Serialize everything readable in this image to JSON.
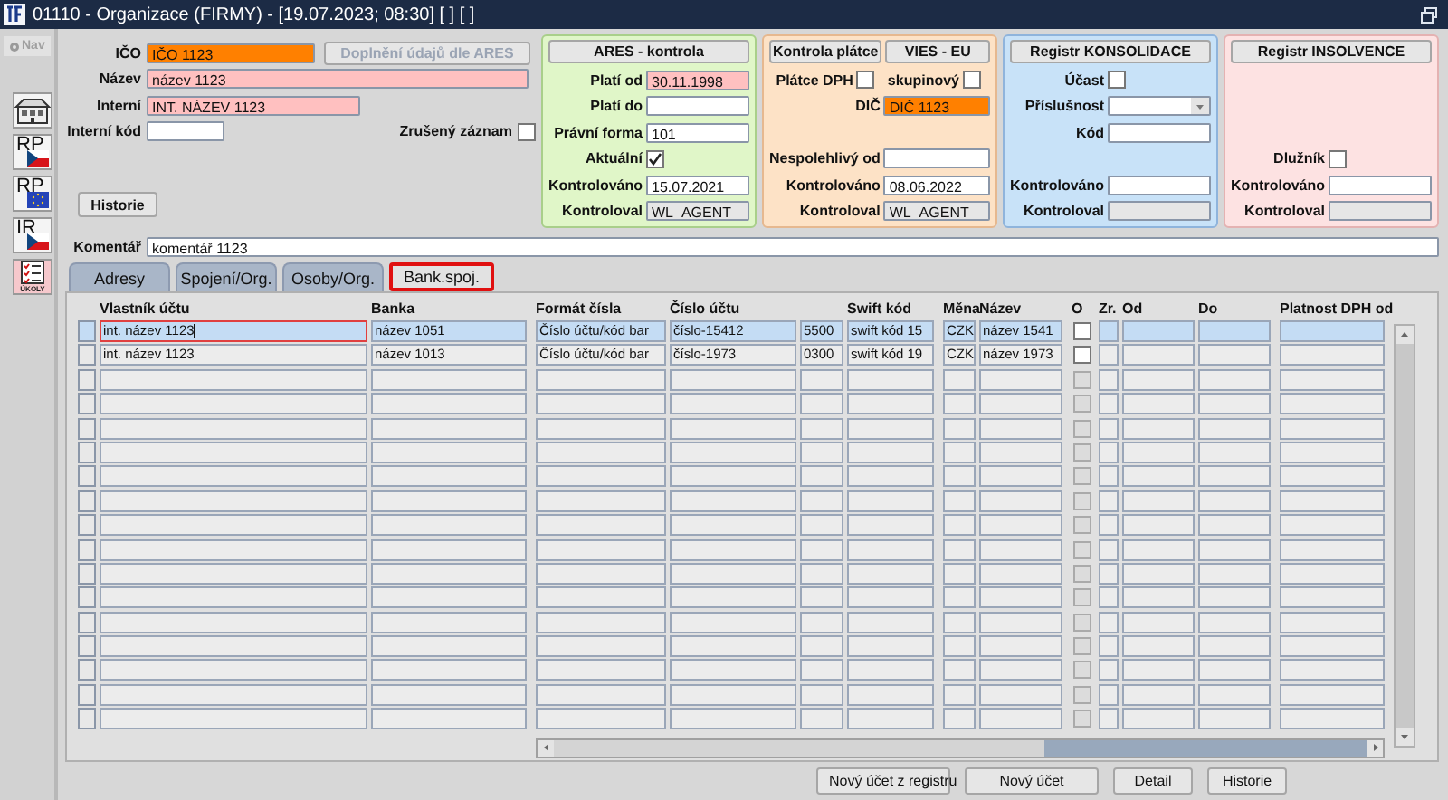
{
  "window": {
    "title": "01110 - Organizace (FIRMY) - [19.07.2023; 08:30] [ ] [ ]"
  },
  "toolbar": {
    "nav": {
      "label": "Nav",
      "disabled": true
    },
    "items": [
      {
        "kind": "building"
      },
      {
        "kind": "flag-cz",
        "label": "RP"
      },
      {
        "kind": "flag-eu",
        "label": "RP"
      },
      {
        "kind": "flag-cz",
        "label": "IR"
      },
      {
        "kind": "tasks",
        "label": "ÚKOLY"
      }
    ]
  },
  "form": {
    "ico": {
      "label": "IČO",
      "value": "IČO 1123",
      "color": "#ff8000"
    },
    "ares_button": {
      "label": "Doplnění údajů dle ARES",
      "disabled": true
    },
    "nazev": {
      "label": "Název",
      "value": "název 1123",
      "color": "#ffc0c0"
    },
    "interni": {
      "label": "Interní",
      "value": "INT. NÁZEV 1123",
      "color": "#ffc0c0"
    },
    "interni_kod": {
      "label": "Interní kód",
      "color": "#ffffff"
    },
    "zruseny": {
      "label": "Zrušený záznam",
      "checked": false
    },
    "historie_button": "Historie"
  },
  "panels": [
    {
      "titles": [
        "ARES - kontrola"
      ],
      "color": "#e0f6c8",
      "top": [
        {
          "kind": "field",
          "label": "Platí od",
          "value": "30.11.1998",
          "color": "#ffc0c0"
        },
        {
          "kind": "field",
          "label": "Platí do",
          "color": "#ffffff"
        },
        {
          "kind": "field",
          "label": "Právní forma",
          "value": "101",
          "color": "#ffffff"
        },
        {
          "kind": "checkbox",
          "label": "Aktuální",
          "checked": true
        }
      ],
      "bottom": [
        {
          "kind": "field",
          "label": "Kontrolováno",
          "value": "15.07.2021",
          "color": "#ffffff"
        },
        {
          "kind": "field",
          "label": "Kontroloval",
          "value": "WL_AGENT",
          "color": "#e6e6e6"
        }
      ]
    },
    {
      "titles": [
        "Kontrola plátce",
        "VIES - EU"
      ],
      "color": "#fde2c6",
      "top": [
        {
          "kind": "checks",
          "items": [
            {
              "label": "Plátce DPH",
              "checked": false
            },
            {
              "label": "skupinový",
              "checked": false
            }
          ]
        },
        {
          "kind": "field",
          "label": "DIČ",
          "value": "DIČ 1123",
          "color": "#ff8000"
        }
      ],
      "bottom": [
        {
          "kind": "field",
          "label": "Nespolehlivý od",
          "color": "#ffffff"
        },
        {
          "kind": "field",
          "label": "Kontrolováno",
          "value": "08.06.2022",
          "color": "#ffffff"
        },
        {
          "kind": "field",
          "label": "Kontroloval",
          "value": "WL_AGENT",
          "color": "#e6e6e6"
        }
      ]
    },
    {
      "titles": [
        "Registr KONSOLIDACE"
      ],
      "color": "#c8e2f8",
      "top": [
        {
          "kind": "checkbox",
          "label": "Účast",
          "checked": false
        },
        {
          "kind": "select",
          "label": "Příslušnost"
        },
        {
          "kind": "field",
          "label": "Kód",
          "color": "#ffffff"
        }
      ],
      "bottom": [
        {
          "kind": "field",
          "label": "Kontrolováno",
          "color": "#ffffff"
        },
        {
          "kind": "field",
          "label": "Kontroloval",
          "color": "#e6e6e6"
        }
      ]
    },
    {
      "titles": [
        "Registr INSOLVENCE"
      ],
      "color": "#fde2e2",
      "bottom": [
        {
          "kind": "checkbox",
          "label": "Dlužník",
          "checked": false
        },
        {
          "kind": "field",
          "label": "Kontrolováno",
          "color": "#ffffff"
        },
        {
          "kind": "field",
          "label": "Kontroloval",
          "color": "#e6e6e6"
        }
      ]
    }
  ],
  "comment": {
    "label": "Komentář",
    "value": "komentář 1123"
  },
  "tabs": [
    {
      "label": "Adresy",
      "selected": false
    },
    {
      "label": "Spojení/Org.",
      "selected": false
    },
    {
      "label": "Osoby/Org.",
      "selected": false
    },
    {
      "label": "Bank.spoj.",
      "selected": true
    }
  ],
  "table": {
    "empty_rows_disabled": true,
    "left_columns": [
      "Vlastník účtu",
      "Banka"
    ],
    "columns": [
      {
        "kind": "text",
        "label": "Formát čísla"
      },
      {
        "kind": "text",
        "label": "Číslo účtu"
      },
      {
        "kind": "text"
      },
      {
        "kind": "text",
        "label": "Swift kód"
      },
      {
        "kind": "text",
        "label": "Měna"
      },
      {
        "kind": "text",
        "label": "Název"
      },
      {
        "kind": "checkbox",
        "label": "O"
      },
      {
        "kind": "text",
        "label": "Zr."
      },
      {
        "kind": "text",
        "label": "Od"
      },
      {
        "kind": "text",
        "label": "Do"
      },
      {
        "kind": "text",
        "label": "Platnost DPH od"
      }
    ],
    "rows": [
      {
        "selected": true,
        "focused": true,
        "owner": "int. název 1123",
        "bank": "název 1051",
        "checked": false,
        "cells": [
          "Číslo účtu/kód bar",
          "číslo-15412",
          "5500",
          "swift kód 15",
          "CZK",
          "název 1541"
        ]
      },
      {
        "selected": false,
        "focused": false,
        "owner": "int. název 1123",
        "bank": "název 1013",
        "checked": false,
        "cells": [
          "Číslo účtu/kód bar",
          "číslo-1973",
          "0300",
          "swift kód 19",
          "CZK",
          "název 1973"
        ]
      }
    ]
  },
  "buttons": [
    "Nový účet z registru",
    "Nový účet",
    "Detail",
    "Historie"
  ]
}
